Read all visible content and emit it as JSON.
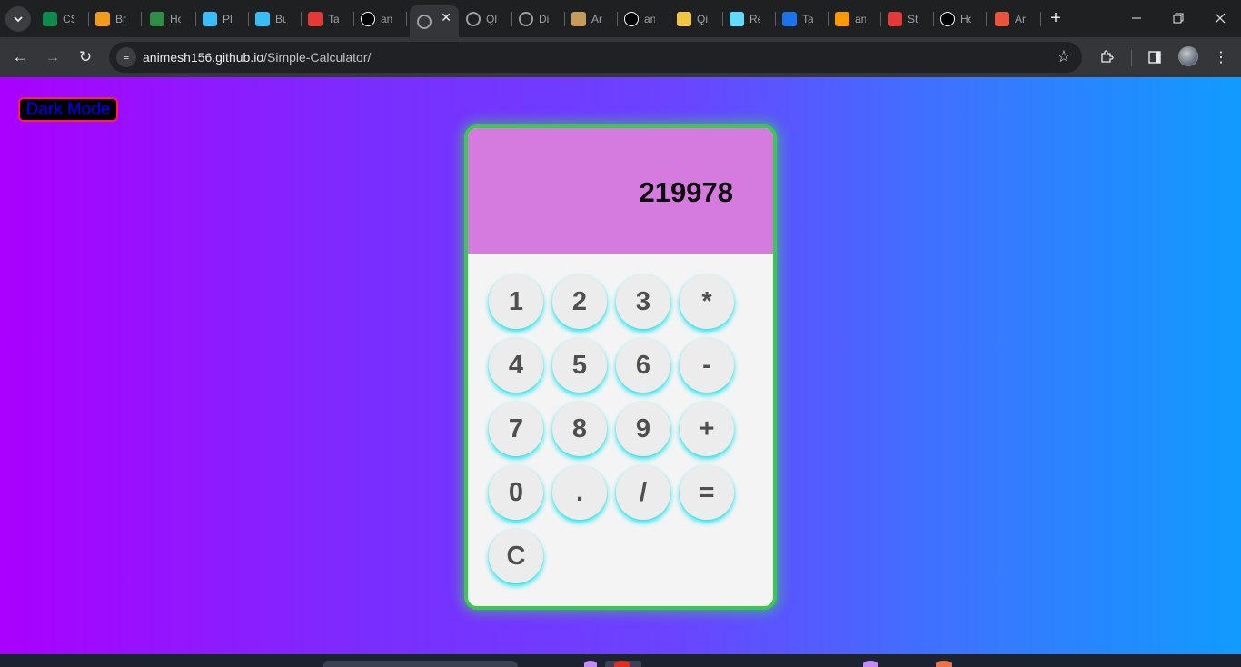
{
  "browser": {
    "tabs": [
      {
        "label": "CS",
        "icon": "w-logo-icon",
        "color": "#0e8a4c"
      },
      {
        "label": "Br",
        "icon": "brevo-logo-icon",
        "color": "#f29a1b"
      },
      {
        "label": "Hc",
        "icon": "geeksforgeeks-icon",
        "color": "#2f8d46"
      },
      {
        "label": "Pl",
        "icon": "tailwind-icon",
        "color": "#38bdf8"
      },
      {
        "label": "Bu",
        "icon": "tailwind-icon",
        "color": "#38bdf8"
      },
      {
        "label": "Ta",
        "icon": "colorful-grid-icon",
        "color": "#e53935"
      },
      {
        "label": "an",
        "icon": "github-icon",
        "color": "#ffffff"
      },
      {
        "label": "",
        "icon": "globe-icon",
        "color": "#9aa0a6",
        "active": true
      },
      {
        "label": "Ql",
        "icon": "globe-icon",
        "color": "#9aa0a6"
      },
      {
        "label": "Di",
        "icon": "globe-icon",
        "color": "#9aa0a6"
      },
      {
        "label": "Ar",
        "icon": "image-icon",
        "color": "#c89b5a"
      },
      {
        "label": "an",
        "icon": "github-icon",
        "color": "#ffffff"
      },
      {
        "label": "Qi",
        "icon": "chat-bubble-icon",
        "color": "#f4c542"
      },
      {
        "label": "Re",
        "icon": "react-icon",
        "color": "#61dafb"
      },
      {
        "label": "Ta",
        "icon": "blue-circle-icon",
        "color": "#1a73e8"
      },
      {
        "label": "an",
        "icon": "amazon-icon",
        "color": "#ff9900"
      },
      {
        "label": "St",
        "icon": "bar-chart-icon",
        "color": "#e53935"
      },
      {
        "label": "Hc",
        "icon": "x-logo-icon",
        "color": "#ffffff"
      },
      {
        "label": "Ar",
        "icon": "archive-icon",
        "color": "#e8553c"
      }
    ],
    "url_host": "animesh156.github.io",
    "url_path": "/Simple-Calculator/"
  },
  "page": {
    "dark_mode_label": "Dark Mode"
  },
  "calculator": {
    "display": "219978",
    "keys": [
      "1",
      "2",
      "3",
      "*",
      "4",
      "5",
      "6",
      "-",
      "7",
      "8",
      "9",
      "+",
      "0",
      ".",
      "/",
      "=",
      "C"
    ]
  },
  "colors": {
    "display_bg": "#d57ade",
    "border": "#39c94b",
    "key_glow": "#1ce4ee",
    "dark_mode_border": "#ff1e4e",
    "dark_mode_text": "#0000ff"
  }
}
